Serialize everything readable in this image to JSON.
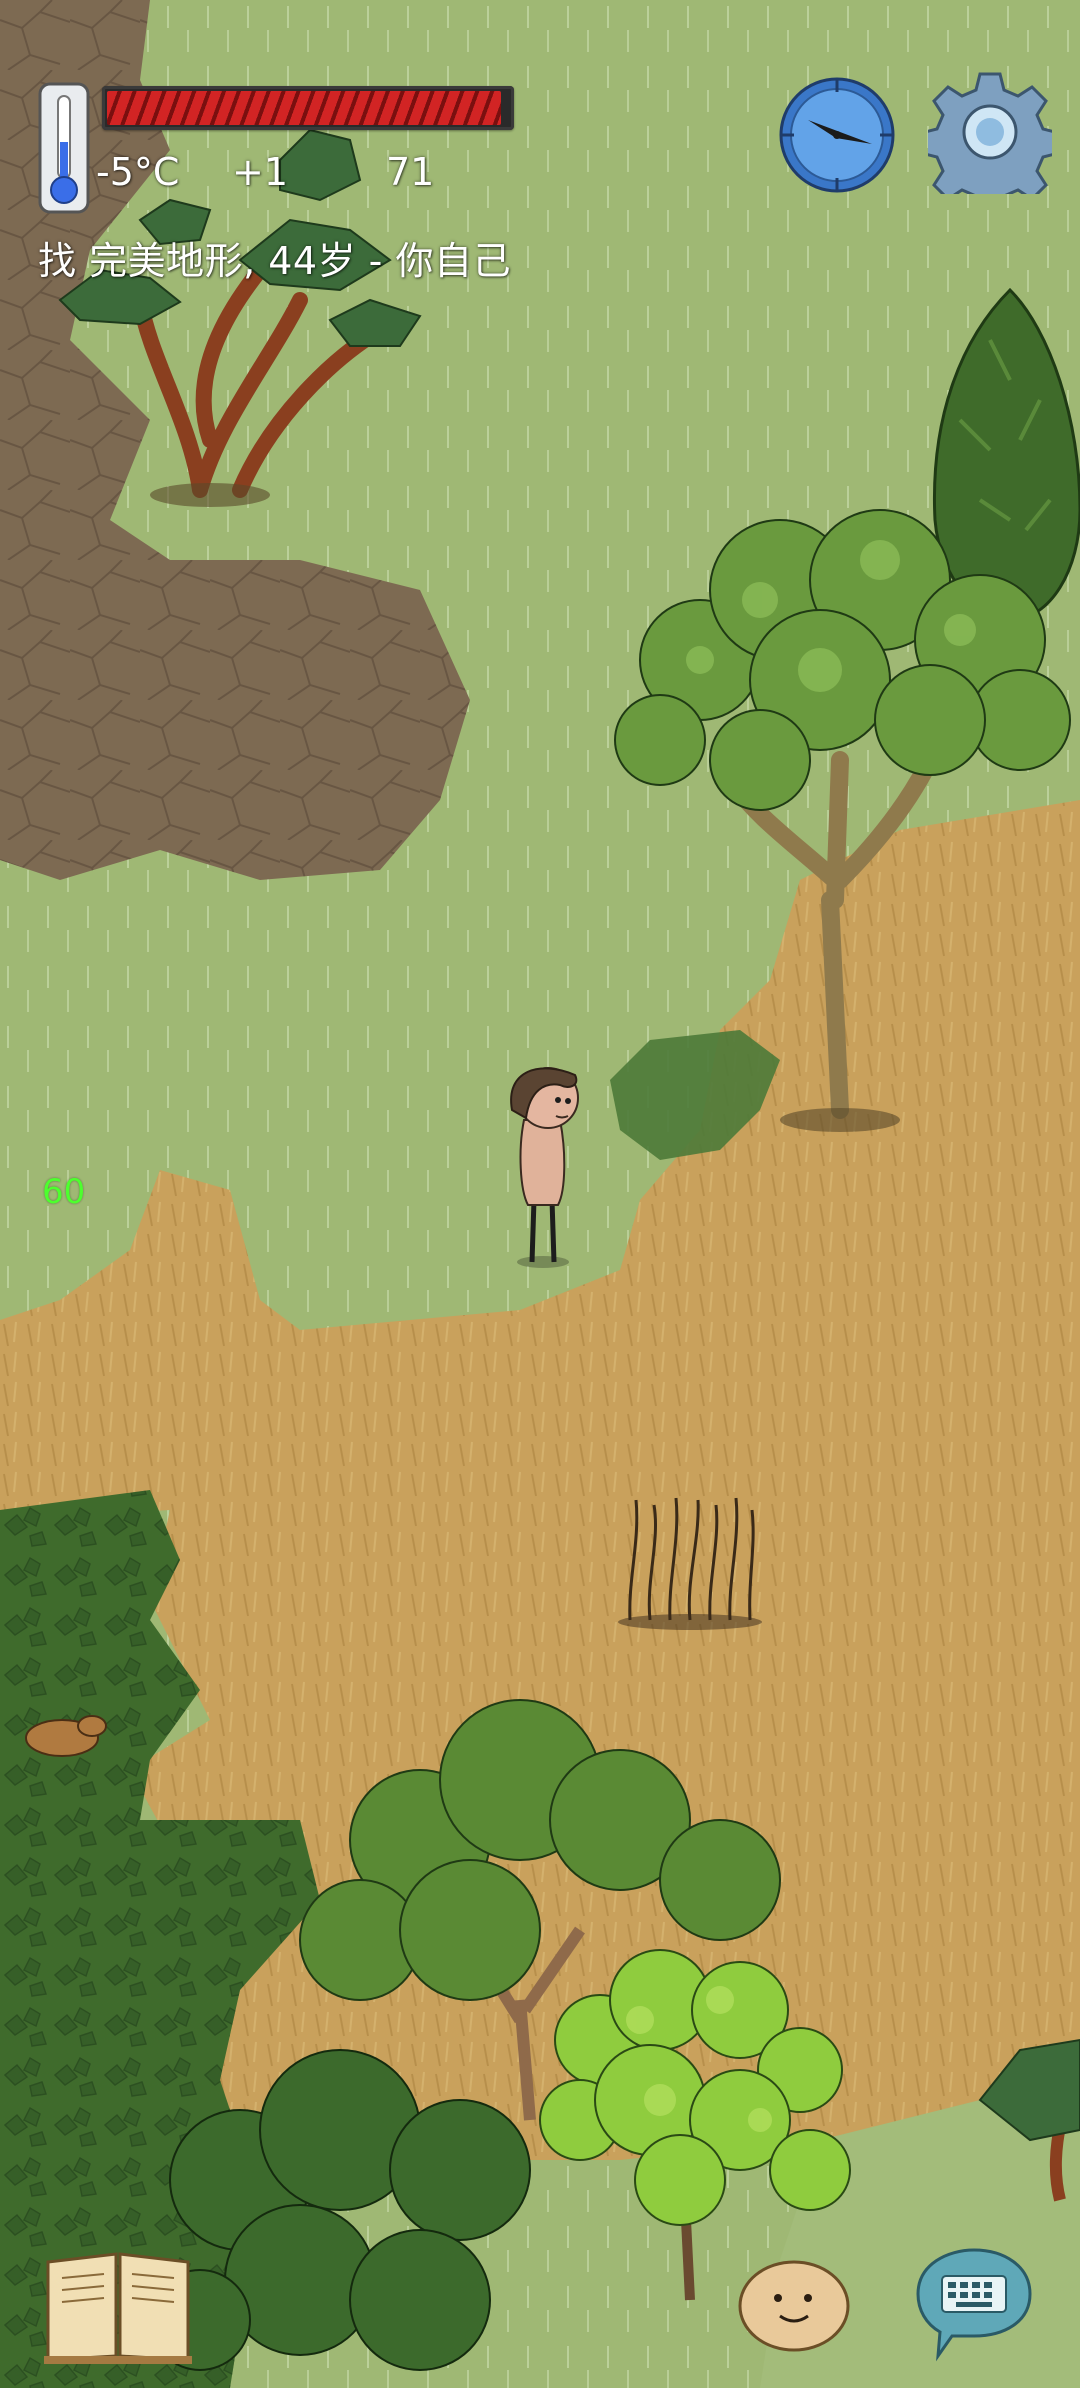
{
  "hud": {
    "temperature": "-5°C",
    "temperature_delta": "+1",
    "food_value": "71",
    "health_level": 0.98,
    "status_line": "找 完美地形, 44岁 - 你自己",
    "fps": "60"
  },
  "icons": {
    "thermometer": "thermometer-icon",
    "compass": "compass-icon",
    "settings": "gear-icon",
    "book": "recipe-book-icon",
    "emote": "emote-face-icon",
    "chat": "keyboard-chat-icon"
  },
  "colors": {
    "health_red": "#d22424",
    "fps_green": "#4dff2e",
    "grass_light": "#9fb874",
    "grass_dark": "#3f6b2c",
    "dirt_brown": "#7d6a52",
    "dry_grass": "#c9a15c"
  }
}
